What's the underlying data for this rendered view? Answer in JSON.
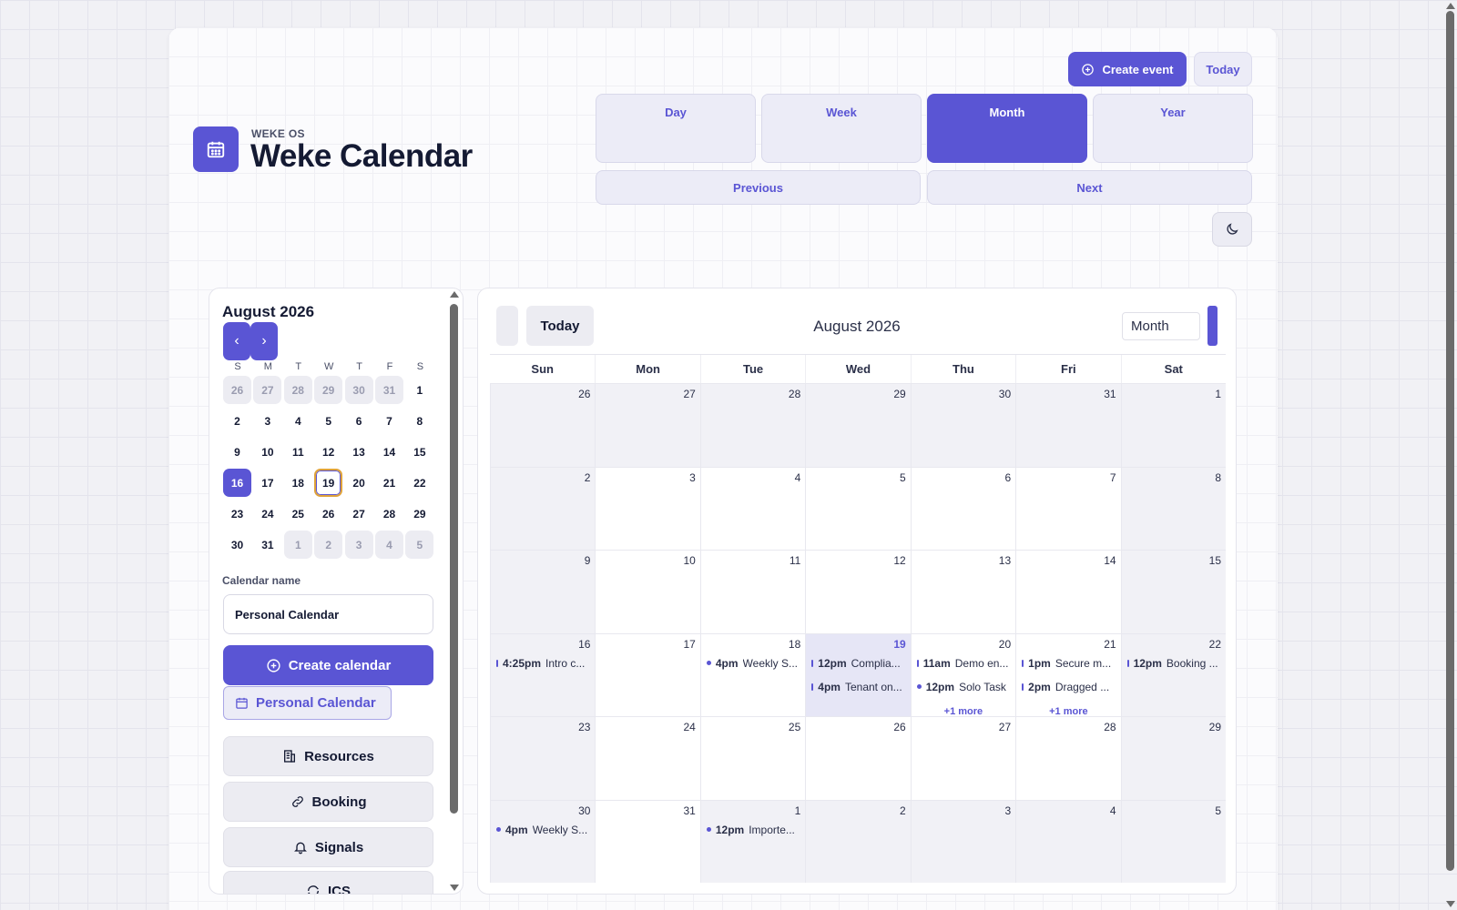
{
  "header": {
    "kicker": "WEKE OS",
    "title": "Weke Calendar",
    "create_event_label": "Create event",
    "today_label": "Today",
    "views": [
      "Day",
      "Week",
      "Month",
      "Year"
    ],
    "active_view": "Month",
    "previous_label": "Previous",
    "next_label": "Next"
  },
  "mini_calendar": {
    "month_label": "August 2026",
    "prev_symbol": "‹",
    "next_symbol": "›",
    "weekdays": [
      "S",
      "M",
      "T",
      "W",
      "T",
      "F",
      "S"
    ],
    "weeks": [
      [
        {
          "d": "26",
          "m": true
        },
        {
          "d": "27",
          "m": true
        },
        {
          "d": "28",
          "m": true
        },
        {
          "d": "29",
          "m": true
        },
        {
          "d": "30",
          "m": true
        },
        {
          "d": "31",
          "m": true
        },
        {
          "d": "1"
        }
      ],
      [
        {
          "d": "2"
        },
        {
          "d": "3"
        },
        {
          "d": "4"
        },
        {
          "d": "5"
        },
        {
          "d": "6"
        },
        {
          "d": "7"
        },
        {
          "d": "8"
        }
      ],
      [
        {
          "d": "9"
        },
        {
          "d": "10"
        },
        {
          "d": "11"
        },
        {
          "d": "12"
        },
        {
          "d": "13"
        },
        {
          "d": "14"
        },
        {
          "d": "15"
        }
      ],
      [
        {
          "d": "16",
          "sel": true
        },
        {
          "d": "17"
        },
        {
          "d": "18"
        },
        {
          "d": "19",
          "today": true
        },
        {
          "d": "20"
        },
        {
          "d": "21"
        },
        {
          "d": "22"
        }
      ],
      [
        {
          "d": "23"
        },
        {
          "d": "24"
        },
        {
          "d": "25"
        },
        {
          "d": "26"
        },
        {
          "d": "27"
        },
        {
          "d": "28"
        },
        {
          "d": "29"
        }
      ],
      [
        {
          "d": "30"
        },
        {
          "d": "31"
        },
        {
          "d": "1",
          "m": true
        },
        {
          "d": "2",
          "m": true
        },
        {
          "d": "3",
          "m": true
        },
        {
          "d": "4",
          "m": true
        },
        {
          "d": "5",
          "m": true
        }
      ]
    ]
  },
  "calendar_form": {
    "label": "Calendar name",
    "value": "Personal Calendar",
    "create_label": "Create calendar",
    "chip_label": "Personal Calendar"
  },
  "side_buttons": [
    {
      "label": "Resources",
      "icon": "building-icon"
    },
    {
      "label": "Booking",
      "icon": "link-icon"
    },
    {
      "label": "Signals",
      "icon": "bell-icon"
    },
    {
      "label": "ICS",
      "icon": "sync-icon"
    }
  ],
  "month_view": {
    "today_label": "Today",
    "title": "August 2026",
    "view_select": "Month",
    "weekdays": [
      "Sun",
      "Mon",
      "Tue",
      "Wed",
      "Thu",
      "Fri",
      "Sat"
    ],
    "weeks": [
      [
        {
          "d": "26",
          "s": true
        },
        {
          "d": "27",
          "s": true
        },
        {
          "d": "28",
          "s": true
        },
        {
          "d": "29",
          "s": true
        },
        {
          "d": "30",
          "s": true
        },
        {
          "d": "31",
          "s": true
        },
        {
          "d": "1",
          "s": true
        }
      ],
      [
        {
          "d": "2",
          "s": true
        },
        {
          "d": "3"
        },
        {
          "d": "4"
        },
        {
          "d": "5"
        },
        {
          "d": "6"
        },
        {
          "d": "7"
        },
        {
          "d": "8",
          "s": true
        }
      ],
      [
        {
          "d": "9",
          "s": true
        },
        {
          "d": "10"
        },
        {
          "d": "11"
        },
        {
          "d": "12"
        },
        {
          "d": "13"
        },
        {
          "d": "14"
        },
        {
          "d": "15",
          "s": true
        }
      ],
      [
        {
          "d": "16",
          "s": true,
          "events": [
            {
              "time": "4:25pm",
              "title": "Intro c...",
              "mark": "bar"
            }
          ]
        },
        {
          "d": "17"
        },
        {
          "d": "18",
          "events": [
            {
              "time": "4pm",
              "title": "Weekly S...",
              "mark": "dot"
            }
          ]
        },
        {
          "d": "19",
          "sel": true,
          "hl": true,
          "events": [
            {
              "time": "12pm",
              "title": "Complia...",
              "mark": "bar"
            },
            {
              "time": "4pm",
              "title": "Tenant on...",
              "mark": "bar"
            }
          ]
        },
        {
          "d": "20",
          "events": [
            {
              "time": "11am",
              "title": "Demo en...",
              "mark": "bar"
            },
            {
              "time": "12pm",
              "title": "Solo Task",
              "mark": "dot"
            }
          ],
          "more": "+1 more"
        },
        {
          "d": "21",
          "events": [
            {
              "time": "1pm",
              "title": "Secure m...",
              "mark": "bar"
            },
            {
              "time": "2pm",
              "title": "Dragged ...",
              "mark": "bar"
            }
          ],
          "more": "+1 more"
        },
        {
          "d": "22",
          "s": true,
          "events": [
            {
              "time": "12pm",
              "title": "Booking ...",
              "mark": "bar"
            }
          ]
        }
      ],
      [
        {
          "d": "23",
          "s": true
        },
        {
          "d": "24"
        },
        {
          "d": "25"
        },
        {
          "d": "26"
        },
        {
          "d": "27"
        },
        {
          "d": "28"
        },
        {
          "d": "29",
          "s": true
        }
      ],
      [
        {
          "d": "30",
          "s": true,
          "events": [
            {
              "time": "4pm",
              "title": "Weekly S...",
              "mark": "dot"
            }
          ]
        },
        {
          "d": "31"
        },
        {
          "d": "1",
          "s": true,
          "events": [
            {
              "time": "12pm",
              "title": "Importe...",
              "mark": "dot"
            }
          ]
        },
        {
          "d": "2",
          "s": true
        },
        {
          "d": "3",
          "s": true
        },
        {
          "d": "4",
          "s": true
        },
        {
          "d": "5",
          "s": true
        }
      ]
    ]
  },
  "colors": {
    "accent": "#5a55d4",
    "today_ring": "#e0a33a"
  }
}
